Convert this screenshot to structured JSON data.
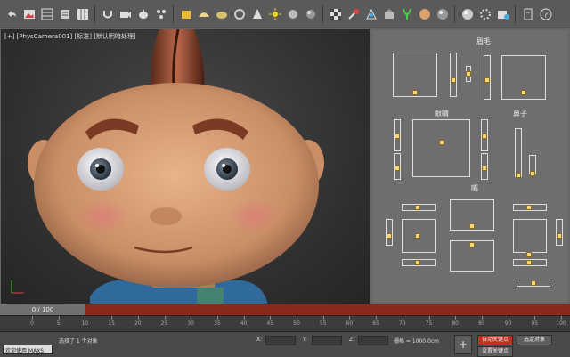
{
  "viewport": {
    "label": "[+] [PhysCamera001] [标准] [默认明暗处理]"
  },
  "control_panel": {
    "eyebrow_label": "眉毛",
    "eyes_label": "眼睛",
    "nose_label": "鼻子",
    "mouth_label": "嘴"
  },
  "timeline": {
    "frame_indicator": "0 / 100",
    "ticks": [
      "0",
      "5",
      "10",
      "15",
      "20",
      "25",
      "30",
      "35",
      "40",
      "45",
      "50",
      "55",
      "60",
      "65",
      "70",
      "75",
      "80",
      "85",
      "90",
      "95",
      "100"
    ]
  },
  "statusbar": {
    "script_label": "欢迎使用 MAXS",
    "selection_text": "选择了 1 个对象",
    "x_label": "X:",
    "y_label": "Y:",
    "z_label": "Z:",
    "grid_text": "栅格 = 1000.0cm",
    "auto_key": "自动关键点",
    "selected_object": "选定对象",
    "set_key": "设置关键点"
  },
  "colors": {
    "trackbar": "#8a2a1a",
    "knob": "#f5d77a",
    "panel": "#6e6e6e"
  }
}
